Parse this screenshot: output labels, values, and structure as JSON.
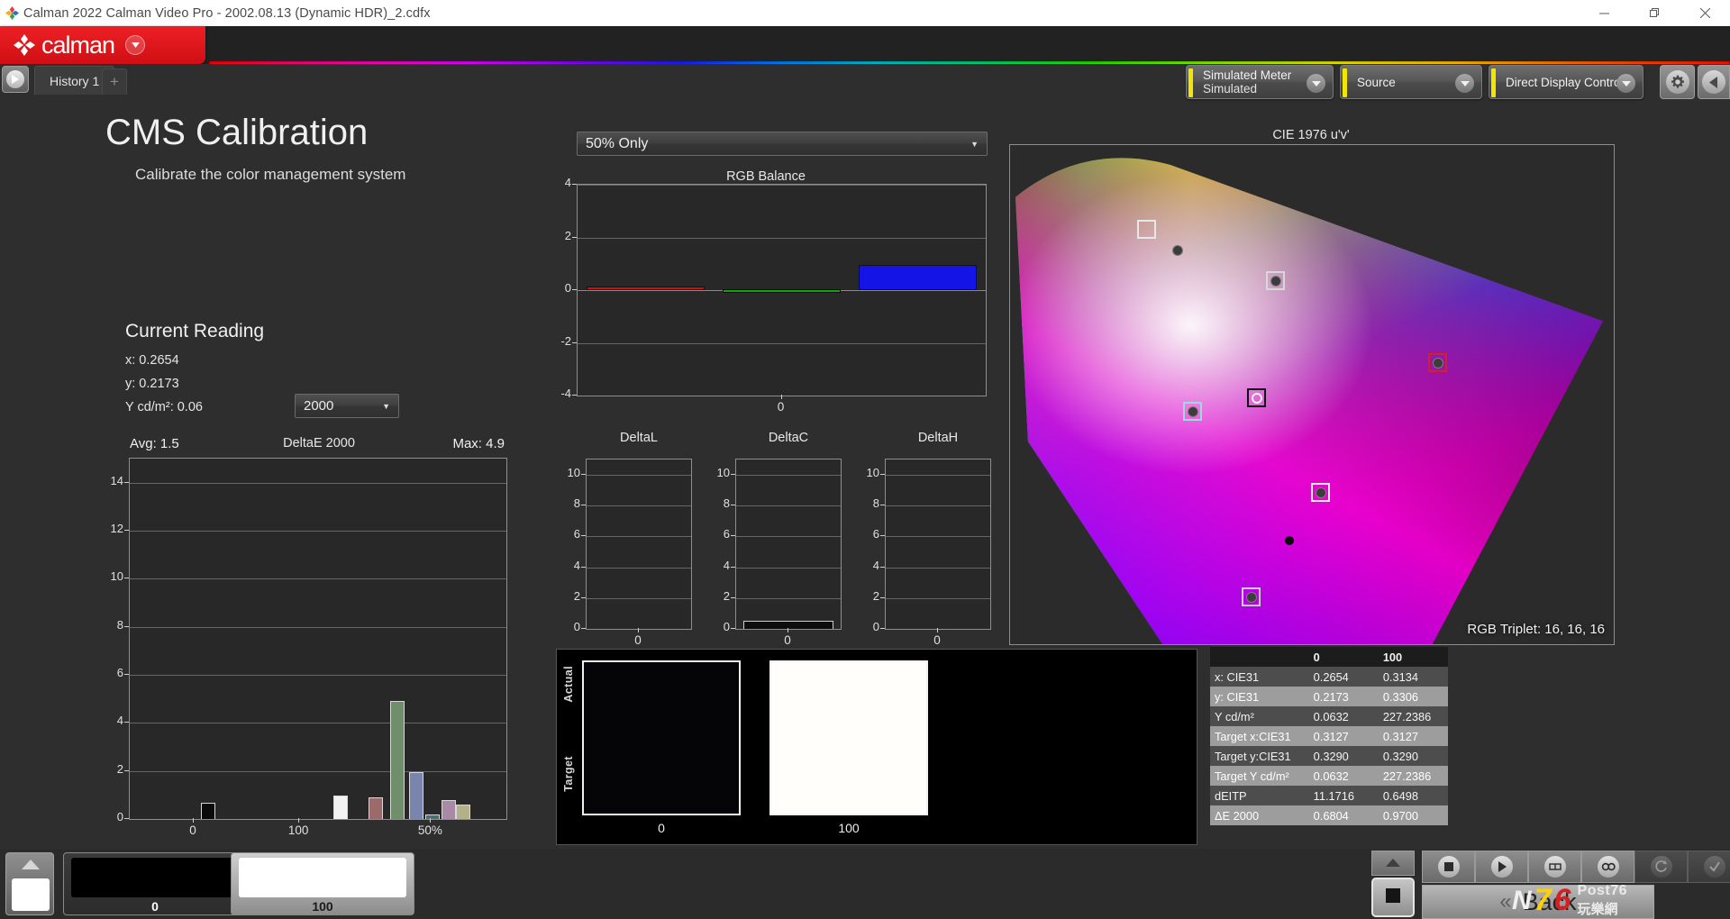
{
  "window": {
    "title": "Calman 2022 Calman Video Pro  - 2002.08.13 (Dynamic HDR)_2.cdfx",
    "minimize_label": "—",
    "maximize_label": "❐",
    "close_label": "✕"
  },
  "brand": {
    "name": "calman",
    "caret_icon": "chevron-down-icon"
  },
  "tabs": {
    "history_label": "History 1",
    "add_label": "+",
    "nav_icon": "play-icon"
  },
  "header": {
    "meter": {
      "line1": "Simulated Meter",
      "line2": "Simulated"
    },
    "source": {
      "line1": "Source",
      "line2": ""
    },
    "ddc": {
      "line1": "Direct Display Control",
      "line2": ""
    },
    "gear_icon": "gear-icon",
    "collapse_icon": "chevron-left-icon"
  },
  "page": {
    "title": "CMS Calibration",
    "subtitle": "Calibrate the color management system"
  },
  "current_reading": {
    "heading": "Current Reading",
    "x": "x: 0.2654",
    "y": "y: 0.2173",
    "Y": "Y cd/m²: 0.06",
    "interval_value": "2000"
  },
  "mode_select": {
    "value": "50% Only"
  },
  "cie": {
    "title": "CIE 1976 u'v'",
    "rgb_triplet": "RGB Triplet: 16, 16, 16"
  },
  "patches": {
    "actual_label": "Actual",
    "target_label": "Target",
    "items": [
      {
        "label": "0",
        "color": "#050508"
      },
      {
        "label": "100",
        "color": "#fffefa"
      }
    ]
  },
  "swatch_bar": {
    "items": [
      {
        "label": "0",
        "color": "#000000"
      },
      {
        "label": "100",
        "color": "#ffffff"
      }
    ],
    "up_icon": "chevron-up-icon"
  },
  "toolbar": {
    "buttons": [
      {
        "name": "stop-button",
        "icon": "stop-icon",
        "dim": false
      },
      {
        "name": "play-button",
        "icon": "play-icon",
        "dim": false
      },
      {
        "name": "measure-button",
        "icon": "measure-icon",
        "dim": false
      },
      {
        "name": "continuous-button",
        "icon": "infinity-icon",
        "dim": false
      },
      {
        "name": "refresh-button",
        "icon": "refresh-icon",
        "dim": true
      },
      {
        "name": "accept-button",
        "icon": "check-icon",
        "dim": true
      }
    ],
    "back_label": "Back",
    "back_chevron": "«",
    "stop_big_icon": "stop-icon",
    "collapse_up_icon": "chevron-up-icon"
  },
  "watermark": {
    "n": "N",
    "seven": "7",
    "six": "6",
    "post": "Post76",
    "cn": "玩樂網"
  },
  "table": {
    "columns": [
      "",
      "0",
      "100"
    ],
    "rows": [
      {
        "label": "x: CIE31",
        "v0": "0.2654",
        "v1": "0.3134"
      },
      {
        "label": "y: CIE31",
        "v0": "0.2173",
        "v1": "0.3306"
      },
      {
        "label": "Y cd/m²",
        "v0": "0.0632",
        "v1": "227.2386"
      },
      {
        "label": "Target x:CIE31",
        "v0": "0.3127",
        "v1": "0.3127"
      },
      {
        "label": "Target y:CIE31",
        "v0": "0.3290",
        "v1": "0.3290"
      },
      {
        "label": "Target Y cd/m²",
        "v0": "0.0632",
        "v1": "227.2386"
      },
      {
        "label": "dEITP",
        "v0": "11.1716",
        "v1": "0.6498"
      },
      {
        "label": "ΔE 2000",
        "v0": "0.6804",
        "v1": "0.9700"
      }
    ]
  },
  "chart_data": [
    {
      "type": "bar",
      "name": "deltae2000",
      "title": "DeltaE 2000",
      "avg_label": "Avg: 1.5",
      "max_label": "Max: 4.9",
      "avg": 1.5,
      "max": 4.9,
      "ylim": [
        0,
        15
      ],
      "yticks": [
        0,
        2,
        4,
        6,
        8,
        10,
        12,
        14
      ],
      "xticks": [
        "0",
        "100",
        "50%"
      ],
      "xlabel": "",
      "ylabel": "",
      "grid": true,
      "categories": [
        "black",
        "white",
        "red",
        "green",
        "blue",
        "cyan",
        "magenta",
        "yellow"
      ],
      "values": [
        0.68,
        0.97,
        0.9,
        4.9,
        1.95,
        0.2,
        0.78,
        0.6
      ],
      "colors": [
        "#0b0b0b",
        "#f2f2f2",
        "#9c6a6a",
        "#6f8f6b",
        "#7a85ad",
        "#4d6f73",
        "#a98aa6",
        "#b3b08a"
      ],
      "bar_x": [
        0.21,
        0.62,
        0.73,
        0.795,
        0.855,
        0.905,
        0.955,
        1.0
      ]
    },
    {
      "type": "bar",
      "name": "rgb_balance",
      "title": "RGB Balance",
      "ylim": [
        -4,
        4
      ],
      "yticks": [
        -4,
        -2,
        0,
        2,
        4
      ],
      "xticks": [
        "0"
      ],
      "grid": true,
      "categories": [
        "R",
        "G",
        "B"
      ],
      "values": [
        0.12,
        0.02,
        0.95
      ],
      "colors": [
        "#cc1111",
        "#15a015",
        "#1414e6"
      ]
    },
    {
      "type": "bar",
      "name": "deltaL",
      "title": "DeltaL",
      "ylim": [
        0,
        11
      ],
      "yticks": [
        0,
        2,
        4,
        6,
        8,
        10
      ],
      "xticks": [
        "0"
      ],
      "grid": true,
      "categories": [
        "0"
      ],
      "values": [
        0
      ],
      "colors": [
        "#111111"
      ]
    },
    {
      "type": "bar",
      "name": "deltaC",
      "title": "DeltaC",
      "ylim": [
        0,
        11
      ],
      "yticks": [
        0,
        2,
        4,
        6,
        8,
        10
      ],
      "xticks": [
        "0"
      ],
      "grid": true,
      "categories": [
        "0"
      ],
      "values": [
        0.55
      ],
      "colors": [
        "#0d0d0d"
      ]
    },
    {
      "type": "bar",
      "name": "deltaH",
      "title": "DeltaH",
      "ylim": [
        0,
        11
      ],
      "yticks": [
        0,
        2,
        4,
        6,
        8,
        10
      ],
      "xticks": [
        "0"
      ],
      "grid": true,
      "categories": [
        "0"
      ],
      "values": [
        0
      ],
      "colors": [
        "#111111"
      ]
    },
    {
      "type": "scatter",
      "name": "cie_1976_uv",
      "title": "CIE 1976 u'v'",
      "xlabel": "u'",
      "ylabel": "v'",
      "points": [
        {
          "name": "green-target",
          "x": 0.14,
          "y": 0.105,
          "marker": "square",
          "boxcolor": "#e8e8e8"
        },
        {
          "name": "green-measured",
          "x": 0.172,
          "y": 0.13,
          "marker": "dot"
        },
        {
          "name": "yellow-measured",
          "x": 0.272,
          "y": 0.168,
          "marker": "dot-box",
          "boxcolor": "#d8d8d8"
        },
        {
          "name": "red-measured",
          "x": 0.438,
          "y": 0.27,
          "marker": "dot-box",
          "boxcolor": "#d82020"
        },
        {
          "name": "cyan-measured",
          "x": 0.187,
          "y": 0.33,
          "marker": "dot-box",
          "boxcolor": "#9fd8dd"
        },
        {
          "name": "white-point",
          "x": 0.253,
          "y": 0.313,
          "marker": "ring-box",
          "boxcolor": "#111111"
        },
        {
          "name": "magenta-measured",
          "x": 0.318,
          "y": 0.43,
          "marker": "dot-box",
          "boxcolor": "#f0f0f0"
        },
        {
          "name": "blue-measured",
          "x": 0.247,
          "y": 0.56,
          "marker": "dot-box",
          "boxcolor": "#cfcfe8"
        },
        {
          "name": "black-point",
          "x": 0.286,
          "y": 0.49,
          "marker": "dot-solid"
        }
      ]
    }
  ]
}
